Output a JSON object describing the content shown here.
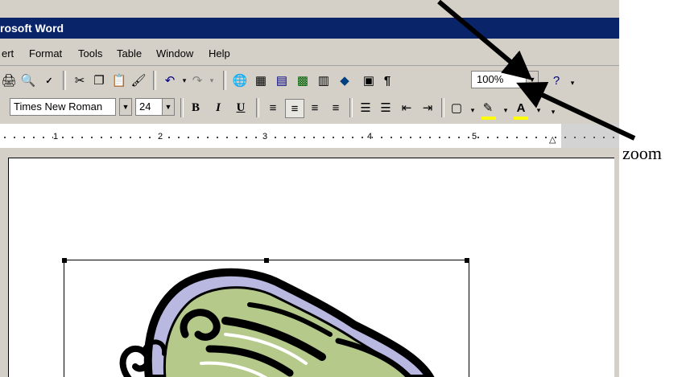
{
  "window": {
    "title": "rosoft Word"
  },
  "menu": {
    "items": [
      {
        "label": "ert"
      },
      {
        "label": "Format"
      },
      {
        "label": "Tools"
      },
      {
        "label": "Table"
      },
      {
        "label": "Window"
      },
      {
        "label": "Help"
      }
    ]
  },
  "toolbar": {
    "zoom_value": "100%"
  },
  "formatting": {
    "font_name": "Times New Roman",
    "font_size": "24",
    "bold_label": "B",
    "italic_label": "I",
    "underline_label": "U"
  },
  "ruler": {
    "numbers": [
      "1",
      "2",
      "3",
      "4",
      "5"
    ]
  },
  "annotation": {
    "label": "zoom"
  },
  "colors": {
    "titlebar": "#0a246a",
    "chrome": "#d4d0c8",
    "frog_green": "#b5c98a",
    "frog_shadow": "#b8b8e0"
  }
}
